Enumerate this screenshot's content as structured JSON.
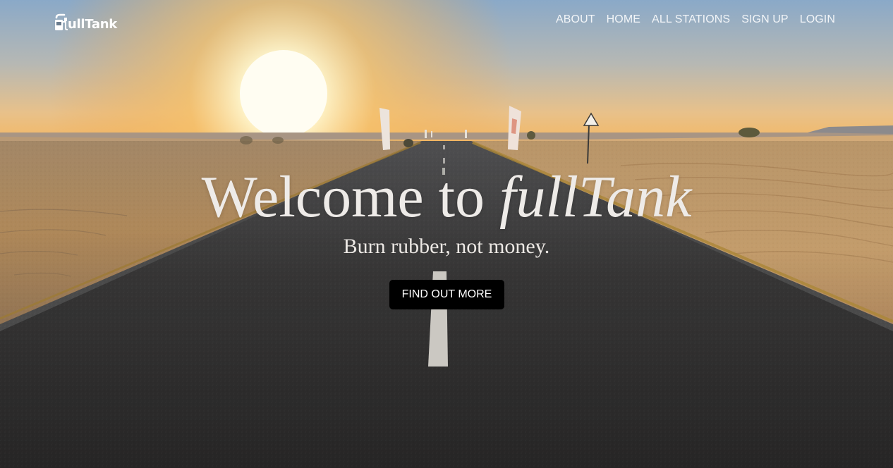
{
  "brand": {
    "logo_text": "ullTank",
    "logo_icon": "fuel-pump-f-icon"
  },
  "nav": {
    "items": [
      {
        "label": "ABOUT"
      },
      {
        "label": "HOME"
      },
      {
        "label": "ALL STATIONS"
      },
      {
        "label": "SIGN UP"
      },
      {
        "label": "LOGIN"
      }
    ]
  },
  "hero": {
    "title_prefix": "Welcome to ",
    "title_brand": "fullTank",
    "subtitle": "Burn rubber, not money.",
    "cta_label": "FIND OUT MORE"
  },
  "colors": {
    "cta_background": "#000000",
    "sky_top": "#7ea3c6",
    "sun": "#fff8d8",
    "sand": "#c89a62",
    "asphalt": "#3a3938"
  }
}
